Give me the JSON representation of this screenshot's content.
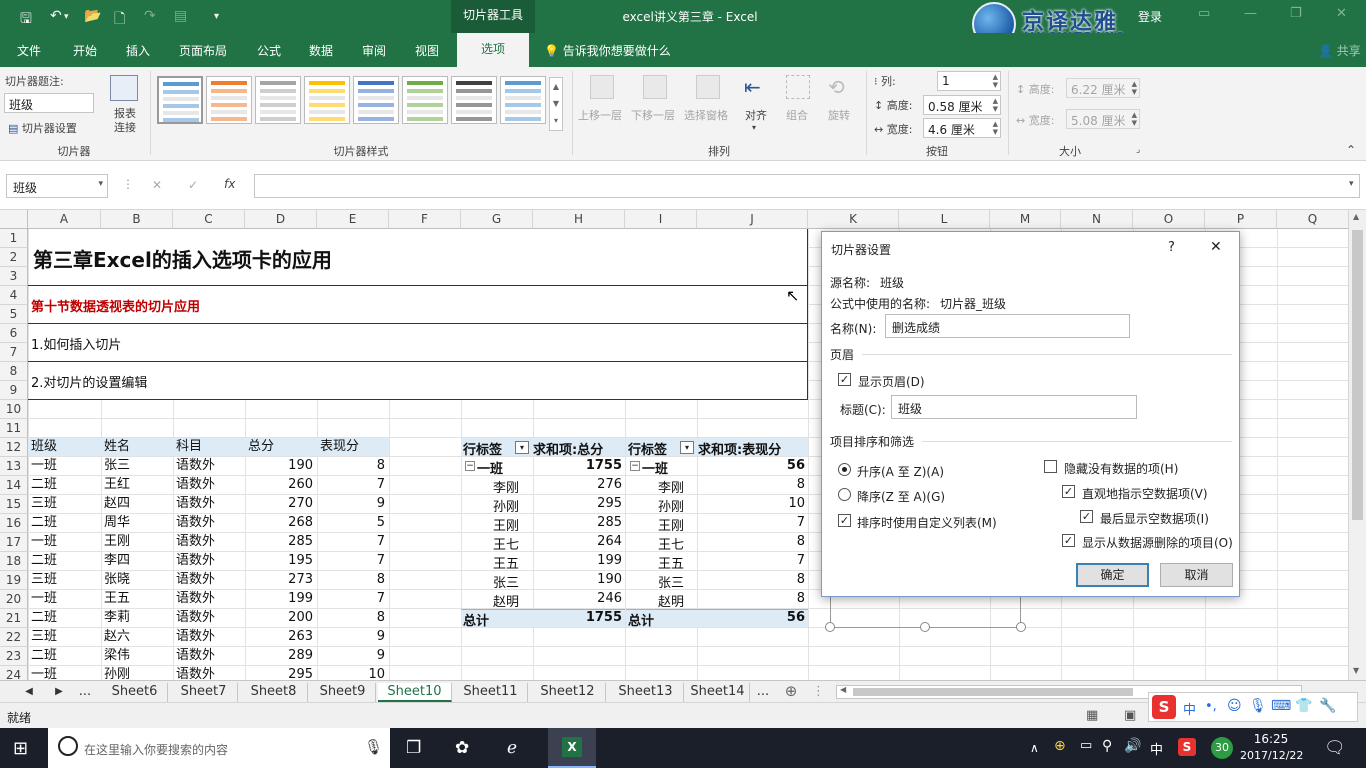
{
  "titlebar": {
    "context_tab": "切片器工具",
    "document_title": "excel讲义第三章 - Excel",
    "login": "登录",
    "logo_cn": "京译达雅",
    "logo_en": "JINGYITRANS"
  },
  "menu": {
    "tabs": [
      "文件",
      "开始",
      "插入",
      "页面布局",
      "公式",
      "数据",
      "审阅",
      "视图",
      "选项"
    ],
    "active": "选项",
    "tell_me": "告诉我你想要做什么",
    "share": "共享"
  },
  "ribbon": {
    "slicer_caption_label": "切片器题注:",
    "slicer_caption_value": "班级",
    "slicer_settings": "切片器设置",
    "report_connections": "报表\n连接",
    "group_slicer": "切片器",
    "group_styles": "切片器样式",
    "arrange_buttons": [
      "上移一层",
      "下移一层",
      "选择窗格",
      "对齐",
      "组合",
      "旋转"
    ],
    "group_arrange": "排列",
    "columns_label": "列:",
    "columns_value": "1",
    "height_label": "高度:",
    "height_value": "0.58 厘米",
    "width_label": "宽度:",
    "width_value": "4.6 厘米",
    "group_buttons": "按钮",
    "size_height_label": "高度:",
    "size_height_value": "6.22 厘米",
    "size_width_label": "宽度:",
    "size_width_value": "5.08 厘米",
    "group_size": "大小"
  },
  "formula_bar": {
    "name_box": "班级",
    "fx": "fx",
    "cancel": "✕",
    "enter": "✓"
  },
  "columns": [
    "A",
    "B",
    "C",
    "D",
    "E",
    "F",
    "G",
    "H",
    "I",
    "J",
    "K",
    "L",
    "M",
    "N",
    "O",
    "P",
    "Q"
  ],
  "rows": [
    "1",
    "2",
    "3",
    "4",
    "5",
    "6",
    "7",
    "8",
    "9",
    "10",
    "11",
    "12",
    "13",
    "14",
    "15",
    "16",
    "17",
    "18",
    "19",
    "20",
    "21",
    "22",
    "23",
    "24"
  ],
  "sheet": {
    "title": "第三章Excel的插入选项卡的应用",
    "section": "第十节数据透视表的切片应用",
    "item1": "1.如何插入切片",
    "item2": "2.对切片的设置编辑",
    "table_headers": [
      "班级",
      "姓名",
      "科目",
      "总分",
      "表现分"
    ],
    "table_rows": [
      [
        "一班",
        "张三",
        "语数外",
        "190",
        "8"
      ],
      [
        "二班",
        "王红",
        "语数外",
        "260",
        "7"
      ],
      [
        "三班",
        "赵四",
        "语数外",
        "270",
        "9"
      ],
      [
        "二班",
        "周华",
        "语数外",
        "268",
        "5"
      ],
      [
        "一班",
        "王刚",
        "语数外",
        "285",
        "7"
      ],
      [
        "二班",
        "李四",
        "语数外",
        "195",
        "7"
      ],
      [
        "三班",
        "张晓",
        "语数外",
        "273",
        "8"
      ],
      [
        "一班",
        "王五",
        "语数外",
        "199",
        "7"
      ],
      [
        "二班",
        "李莉",
        "语数外",
        "200",
        "8"
      ],
      [
        "三班",
        "赵六",
        "语数外",
        "263",
        "9"
      ],
      [
        "二班",
        "梁伟",
        "语数外",
        "289",
        "9"
      ],
      [
        "一班",
        "孙刚",
        "语数外",
        "295",
        "10"
      ]
    ],
    "pivot1": {
      "row_label": "行标签",
      "value_label": "求和项:总分",
      "group": "一班",
      "group_total": "1755",
      "items": [
        [
          "李刚",
          "276"
        ],
        [
          "孙刚",
          "295"
        ],
        [
          "王刚",
          "285"
        ],
        [
          "王七",
          "264"
        ],
        [
          "王五",
          "199"
        ],
        [
          "张三",
          "190"
        ],
        [
          "赵明",
          "246"
        ]
      ],
      "total_label": "总计",
      "total": "1755"
    },
    "pivot2": {
      "row_label": "行标签",
      "value_label": "求和项:表现分",
      "group": "一班",
      "group_total": "56",
      "items": [
        [
          "李刚",
          "8"
        ],
        [
          "孙刚",
          "10"
        ],
        [
          "王刚",
          "7"
        ],
        [
          "王七",
          "8"
        ],
        [
          "王五",
          "7"
        ],
        [
          "张三",
          "8"
        ],
        [
          "赵明",
          "8"
        ]
      ],
      "total_label": "总计",
      "total": "56"
    }
  },
  "sheet_tabs": {
    "items": [
      "Sheet6",
      "Sheet7",
      "Sheet8",
      "Sheet9",
      "Sheet10",
      "Sheet11",
      "Sheet12",
      "Sheet13",
      "Sheet14"
    ],
    "active": "Sheet10",
    "more": "..."
  },
  "status": {
    "ready": "就绪"
  },
  "dialog": {
    "title": "切片器设置",
    "help": "?",
    "close": "✕",
    "source_label": "源名称:",
    "source_value": "班级",
    "formula_name_label": "公式中使用的名称:",
    "formula_name_value": "切片器_班级",
    "name_label": "名称(N):",
    "name_value": "删选成绩",
    "header_section": "页眉",
    "show_header": "显示页眉(D)",
    "caption_label": "标题(C):",
    "caption_value": "班级",
    "sort_section": "项目排序和筛选",
    "asc": "升序(A 至 Z)(A)",
    "desc": "降序(Z 至 A)(G)",
    "custom_list": "排序时使用自定义列表(M)",
    "hide_no_data": "隐藏没有数据的项(H)",
    "visual_indicate": "直观地指示空数据项(V)",
    "show_last": "最后显示空数据项(I)",
    "show_deleted": "显示从数据源删除的项目(O)",
    "ok": "确定",
    "cancel": "取消"
  },
  "taskbar": {
    "search_placeholder": "在这里输入你要搜索的内容",
    "time": "16:25",
    "date": "2017/12/22",
    "ime": "中",
    "notify_badge": "30"
  },
  "colors": {
    "excel_green": "#217346",
    "pivot_header": "#ddebf7",
    "section_red": "#c00000"
  }
}
